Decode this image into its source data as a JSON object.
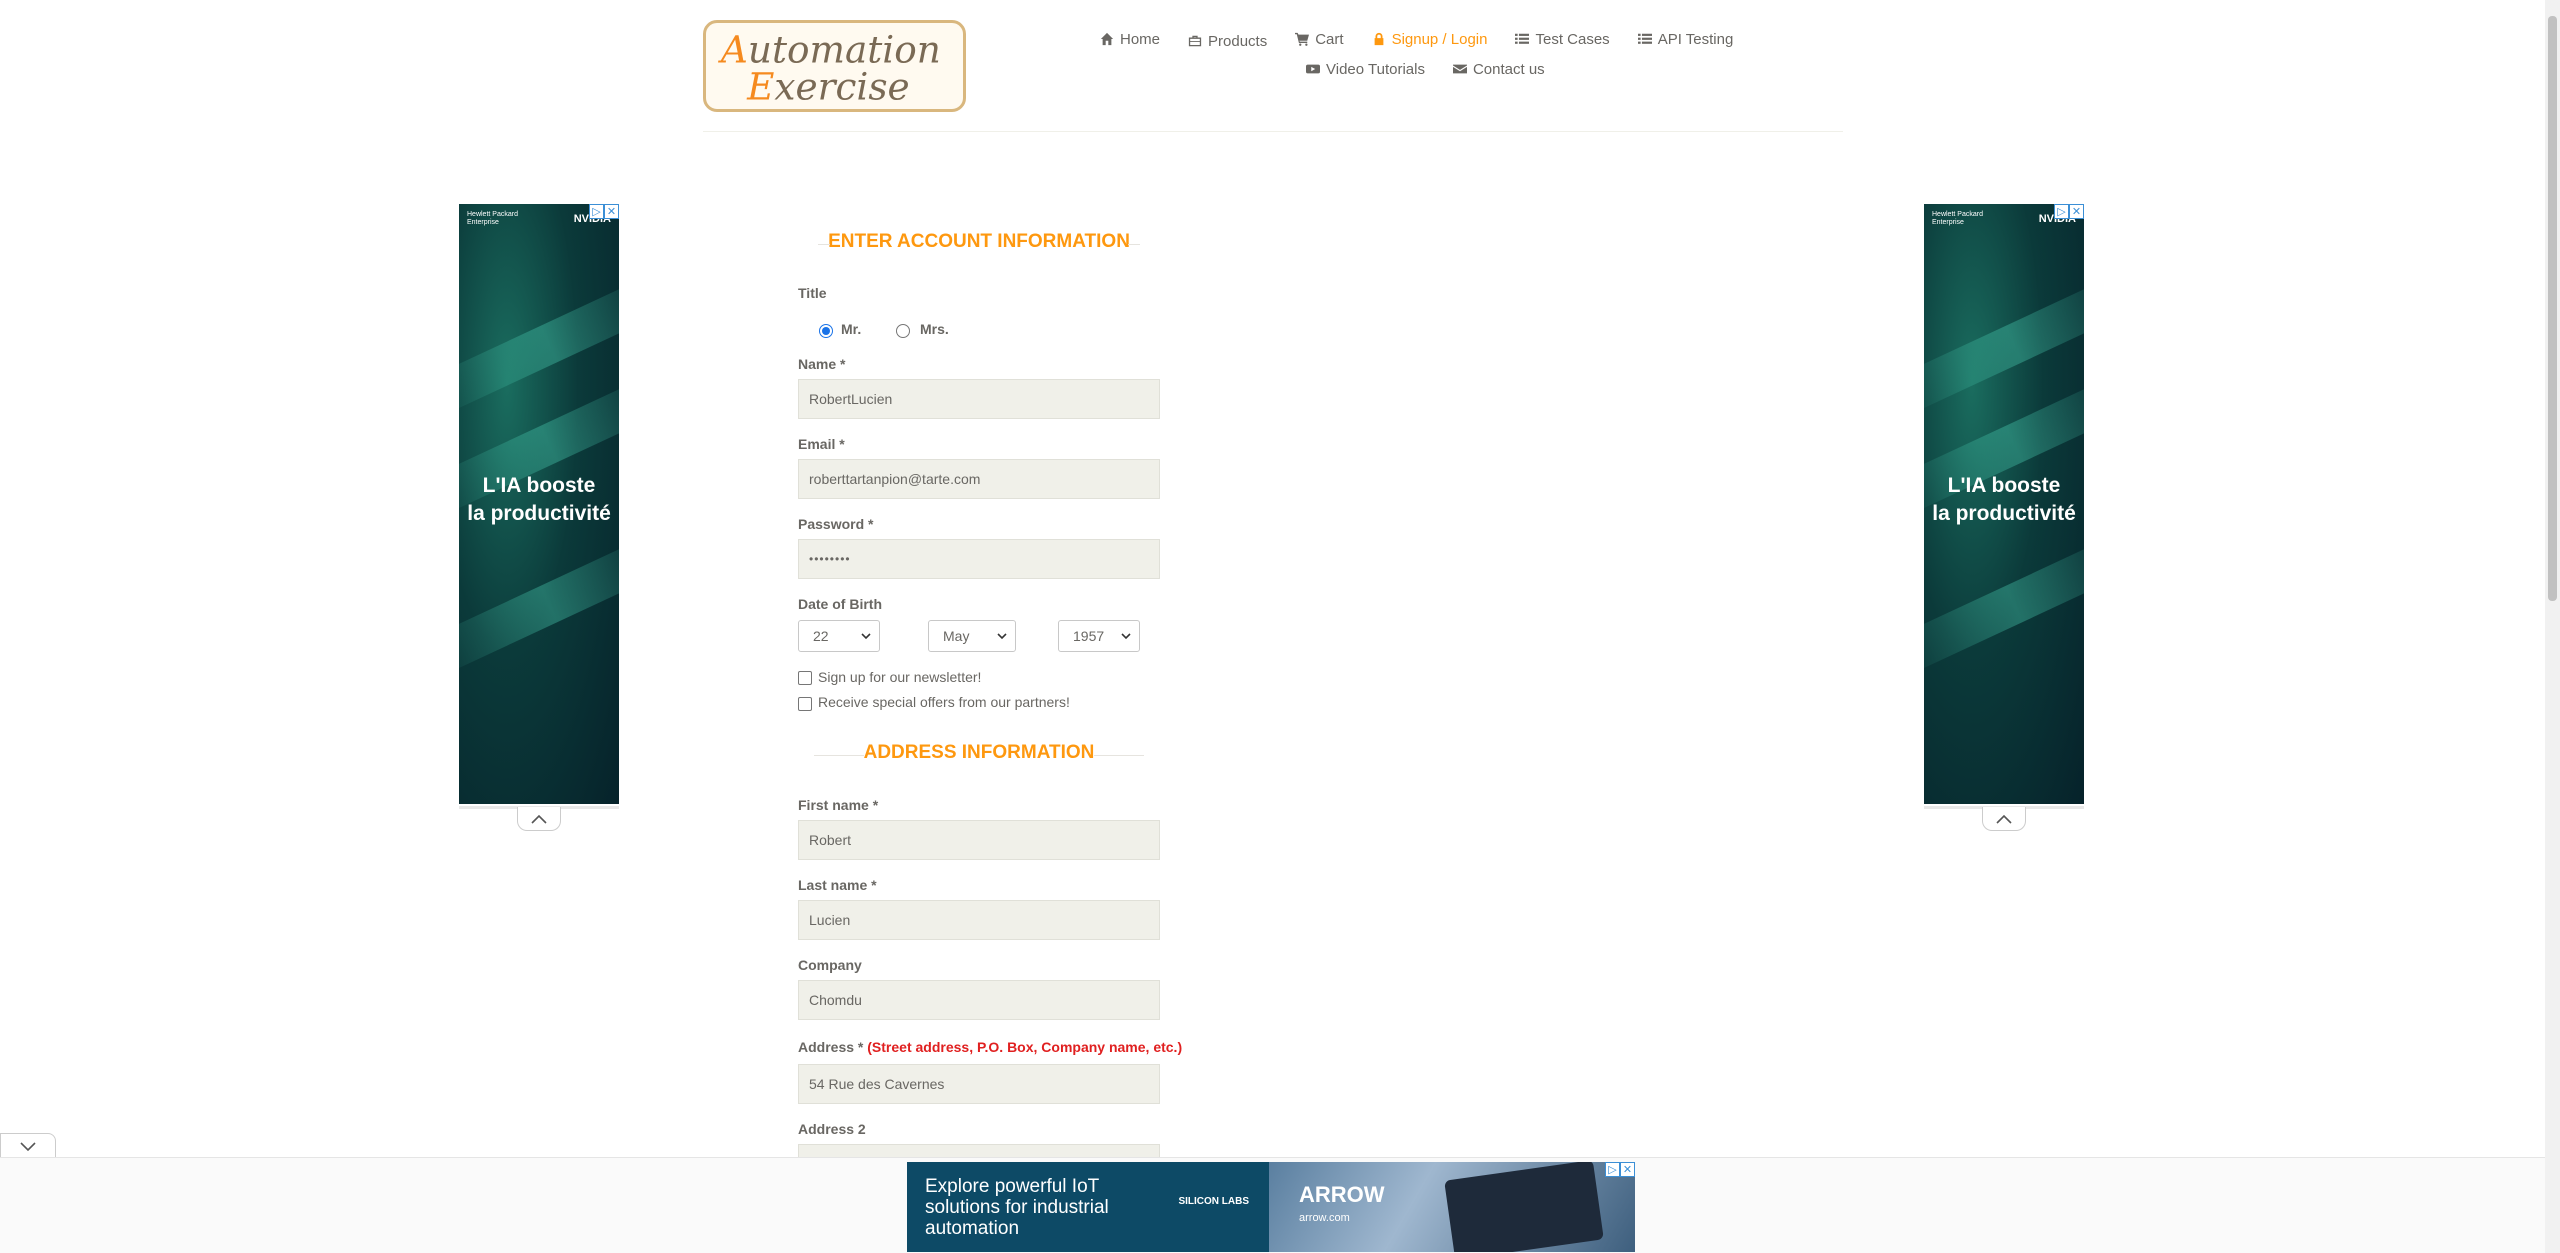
{
  "logo": {
    "text_line1": "Automation",
    "text_line2": "Exercise"
  },
  "nav": {
    "items": [
      {
        "label": "Home",
        "icon": "home-icon"
      },
      {
        "label": "Products",
        "icon": "products-icon"
      },
      {
        "label": "Cart",
        "icon": "cart-icon"
      },
      {
        "label": "Signup / Login",
        "icon": "lock-icon",
        "active": true
      },
      {
        "label": "Test Cases",
        "icon": "list-icon"
      },
      {
        "label": "API Testing",
        "icon": "list-icon"
      },
      {
        "label": "Video Tutorials",
        "icon": "youtube-icon"
      },
      {
        "label": "Contact us",
        "icon": "envelope-icon"
      }
    ]
  },
  "account": {
    "heading": "ENTER ACCOUNT INFORMATION",
    "title_label": "Title",
    "title_options": [
      "Mr.",
      "Mrs."
    ],
    "title_selected": "Mr.",
    "name_label": "Name",
    "name_value": "RobertLucien",
    "email_label": "Email",
    "email_value": "roberttartanpion@tarte.com",
    "password_label": "Password",
    "password_value": "••••••••",
    "dob_label": "Date of Birth",
    "dob_day": "22",
    "dob_month": "May",
    "dob_year": "1957",
    "newsletter_label": "Sign up for our newsletter!",
    "offers_label": "Receive special offers from our partners!",
    "required_mark": "*"
  },
  "address": {
    "heading": "ADDRESS INFORMATION",
    "first_name_label": "First name",
    "first_name_value": "Robert",
    "last_name_label": "Last name",
    "last_name_value": "Lucien",
    "company_label": "Company",
    "company_value": "Chomdu",
    "address_label": "Address",
    "address_hint": "(Street address, P.O. Box, Company name, etc.)",
    "address_value": "54 Rue des Cavernes",
    "address2_label": "Address 2"
  },
  "side_ad": {
    "brand_left": "Hewlett Packard Enterprise",
    "brand_right": "NVIDIA",
    "line1": "L'IA booste",
    "line2": "la productivité"
  },
  "bottom_ad": {
    "text": "Explore powerful IoT solutions for industrial automation",
    "brand": "SILICON LABS",
    "partner": "ARROW",
    "partner_url": "arrow.com"
  },
  "colors": {
    "accent": "#fe980f",
    "text": "#696763",
    "input_bg": "#f0f0e9",
    "hint": "#e02020"
  }
}
